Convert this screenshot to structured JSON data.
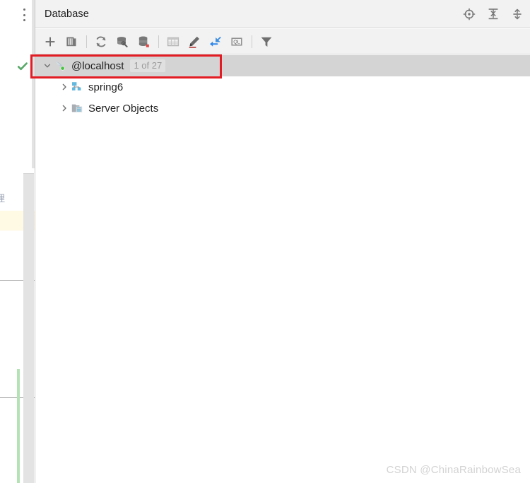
{
  "window": {
    "tool_window_title": "Database"
  },
  "rail": {
    "menu_icon": "more-vertical-icon"
  },
  "header_actions": [
    {
      "name": "scroll-from-source-icon",
      "tooltip": "Scroll from Source"
    },
    {
      "name": "expand-all-icon",
      "tooltip": "Expand All"
    },
    {
      "name": "collapse-all-icon",
      "tooltip": "Collapse All"
    }
  ],
  "toolbar": [
    {
      "name": "add-icon",
      "tooltip": "New"
    },
    {
      "name": "duplicate-icon",
      "tooltip": "Duplicate"
    },
    {
      "name": "separator-1",
      "tooltip": ""
    },
    {
      "name": "refresh-icon",
      "tooltip": "Refresh"
    },
    {
      "name": "database-tools-icon",
      "tooltip": "Database Tools"
    },
    {
      "name": "data-sources-properties-icon",
      "tooltip": "Data Source Properties"
    },
    {
      "name": "separator-2",
      "tooltip": ""
    },
    {
      "name": "table-grid-icon",
      "tooltip": "Open Table Editor"
    },
    {
      "name": "edit-pencil-icon",
      "tooltip": "Modify Object"
    },
    {
      "name": "jump-to-editor-icon",
      "tooltip": "Jump to Query Console"
    },
    {
      "name": "ql-console-icon",
      "tooltip": "Open Console"
    },
    {
      "name": "separator-3",
      "tooltip": ""
    },
    {
      "name": "filter-icon",
      "tooltip": "Filter"
    }
  ],
  "tree": {
    "nodes": [
      {
        "label": "@localhost",
        "badge": "1 of 27",
        "icon": "mysql-dolphin-connected-icon",
        "expanded": true,
        "selected": true,
        "indent": 1
      },
      {
        "label": "spring6",
        "badge": "",
        "icon": "schema-icon",
        "expanded": false,
        "selected": false,
        "indent": 2
      },
      {
        "label": "Server Objects",
        "badge": "",
        "icon": "server-objects-folder-icon",
        "expanded": false,
        "selected": false,
        "indent": 2
      }
    ]
  },
  "editor_background": {
    "clipped_text": "理",
    "gutter_status_icon": "green-check-icon",
    "change_marker_color": "#b5e2b5"
  },
  "annotation": {
    "type": "rectangle",
    "color": "#e31b23",
    "target": "@localhost"
  },
  "watermark": {
    "text": "CSDN @ChinaRainbowSea"
  },
  "colors": {
    "toolwindow_header_bg": "#f2f2f2",
    "selection_bg": "#d4d4d4",
    "accent_red": "#e31b23",
    "status_green": "#59a869",
    "schema_blue": "#62b8de"
  }
}
